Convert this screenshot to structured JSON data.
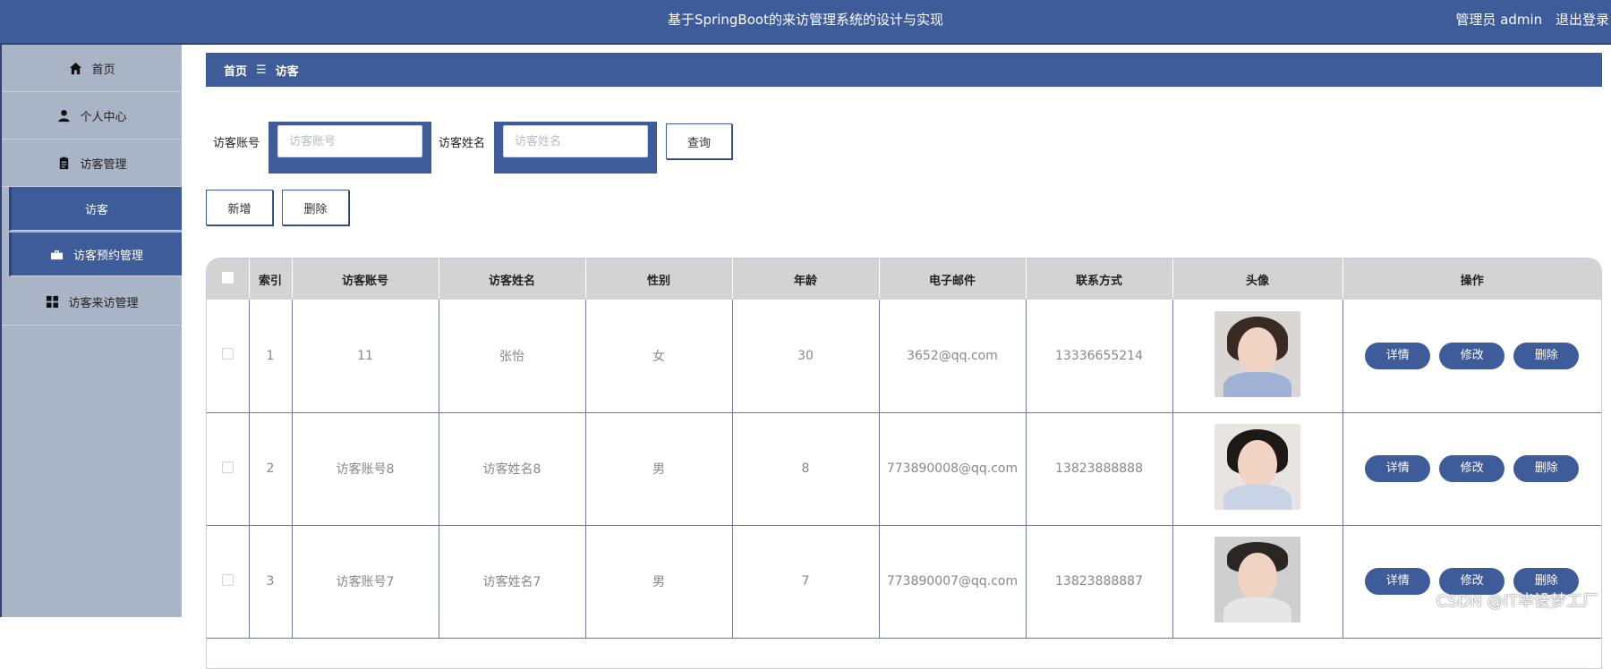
{
  "header": {
    "title": "基于SpringBoot的来访管理系统的设计与实现",
    "user_label": "管理员 admin",
    "logout_label": "退出登录"
  },
  "sidebar": {
    "items": [
      {
        "label": "首页",
        "icon": "home-icon"
      },
      {
        "label": "个人中心",
        "icon": "user-icon"
      },
      {
        "label": "访客管理",
        "icon": "clipboard-icon"
      },
      {
        "label": "访客",
        "icon": ""
      },
      {
        "label": "访客预约管理",
        "icon": "briefcase-icon"
      },
      {
        "label": "访客来访管理",
        "icon": "grid-icon"
      }
    ]
  },
  "breadcrumb": {
    "home": "首页",
    "separator": "☰",
    "current": "访客"
  },
  "search": {
    "account_label": "访客账号",
    "account_placeholder": "访客账号",
    "name_label": "访客姓名",
    "name_placeholder": "访客姓名",
    "query_label": "查询"
  },
  "actions": {
    "add_label": "新增",
    "delete_label": "删除"
  },
  "table": {
    "columns": [
      "索引",
      "访客账号",
      "访客姓名",
      "性别",
      "年龄",
      "电子邮件",
      "联系方式",
      "头像",
      "操作"
    ],
    "rows": [
      {
        "index": "1",
        "account": "11",
        "name": "张怡",
        "gender": "女",
        "age": "30",
        "email": "3652@qq.com",
        "phone": "13336655214"
      },
      {
        "index": "2",
        "account": "访客账号8",
        "name": "访客姓名8",
        "gender": "男",
        "age": "8",
        "email": "773890008@qq.com",
        "phone": "13823888888"
      },
      {
        "index": "3",
        "account": "访客账号7",
        "name": "访客姓名7",
        "gender": "男",
        "age": "7",
        "email": "773890007@qq.com",
        "phone": "13823888887"
      }
    ],
    "row_actions": {
      "detail": "详情",
      "edit": "修改",
      "delete": "删除"
    }
  },
  "watermark": "CSDN @IT毕设梦工厂",
  "colors": {
    "primary": "#3e5c9a",
    "sidebar": "#a9b4c7",
    "table_header": "#d3d3d3"
  }
}
